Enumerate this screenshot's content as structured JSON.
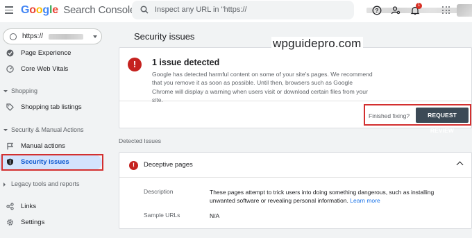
{
  "topbar": {
    "logo_google": "Google",
    "logo_product": "Search Console",
    "search_placeholder": "Inspect any URL in \"https://",
    "search_tail": "/",
    "notification_count": "1"
  },
  "sidebar": {
    "property_url": "https://",
    "items": [
      {
        "label": "Page Experience",
        "icon": "page-experience-icon"
      },
      {
        "label": "Core Web Vitals",
        "icon": "speedometer-icon"
      }
    ],
    "sections": [
      {
        "label": "Shopping"
      },
      {
        "label": "Security & Manual Actions"
      },
      {
        "label": "Legacy tools and reports"
      }
    ],
    "shopping_items": [
      {
        "label": "Shopping tab listings",
        "icon": "tag-icon"
      }
    ],
    "security_items": [
      {
        "label": "Manual actions",
        "icon": "flag-icon"
      },
      {
        "label": "Security issues",
        "icon": "shield-icon"
      }
    ],
    "bottom_items": [
      {
        "label": "Links",
        "icon": "links-icon"
      },
      {
        "label": "Settings",
        "icon": "gear-icon"
      }
    ]
  },
  "main": {
    "page_title": "Security issues",
    "issue_card": {
      "title": "1 issue detected",
      "description": "Google has detected harmful content on some of your site's pages. We recommend that you remove it as soon as possible. Until then, browsers such as Google Chrome will display a warning when users visit or download certain files from your site.",
      "finished_label": "Finished fixing?",
      "request_review_label": "REQUEST REVIEW"
    },
    "watermark": "wpguidepro.com",
    "detected_label": "Detected Issues",
    "detail_card": {
      "title": "Deceptive pages",
      "description_label": "Description",
      "description_value": "These pages attempt to trick users into doing something dangerous, such as installing unwanted software or revealing personal information.",
      "learn_more": "Learn more",
      "sample_urls_label": "Sample URLs",
      "sample_urls_value": "N/A"
    }
  },
  "colors": {
    "accent_red": "#c5221f",
    "highlight_box": "#d32f2f",
    "active_nav": "#d3e3fd",
    "button_dark": "#3c4a56"
  }
}
